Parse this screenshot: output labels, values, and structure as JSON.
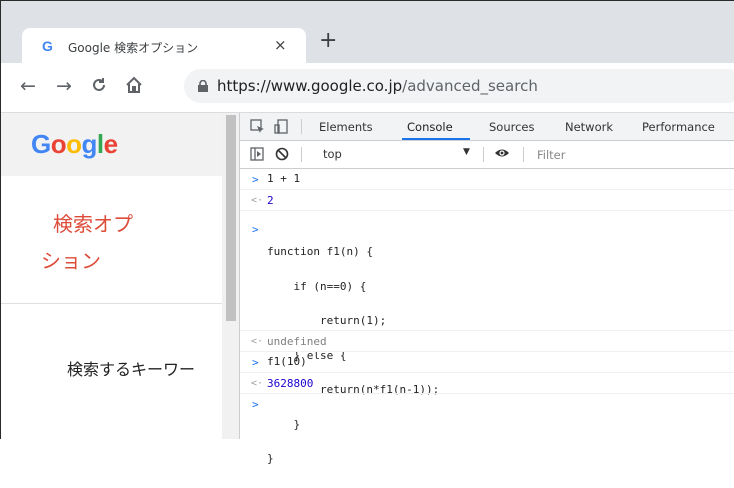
{
  "browser": {
    "tab_title": "Google 検索オプション",
    "tab_favicon": "G",
    "tab_close": "×",
    "new_tab": "+",
    "url_host": "https://www.google.co.jp",
    "url_path": "/advanced_search"
  },
  "icons": {
    "back": "←",
    "forward": "→",
    "reload": "↻",
    "home": "⌂",
    "lock": "lock-icon"
  },
  "page": {
    "logo_letters": [
      "G",
      "o",
      "o",
      "g",
      "l",
      "e"
    ],
    "logo_colors": [
      "#4285f4",
      "#ea4335",
      "#fbbc05",
      "#4285f4",
      "#34a853",
      "#ea4335"
    ],
    "title_line1": "検索オプ",
    "title_line2": "ション",
    "field_label": "検索するキーワー"
  },
  "devtools": {
    "tabs": [
      "Elements",
      "Console",
      "Sources",
      "Network",
      "Performance"
    ],
    "active_tab": "Console",
    "context": "top",
    "filter_placeholder": "Filter"
  },
  "console": {
    "input1": "1 + 1",
    "output1": "2",
    "function_lines": [
      "function f1(n) {",
      "    if (n==0) {",
      "        return(1);",
      "    } else {",
      "        return(n*f1(n-1));",
      "    }",
      "}"
    ],
    "output2": "undefined",
    "input3": "f1(10)",
    "output3": "3628800",
    "prompt": ">",
    "result_marker": "<·"
  }
}
